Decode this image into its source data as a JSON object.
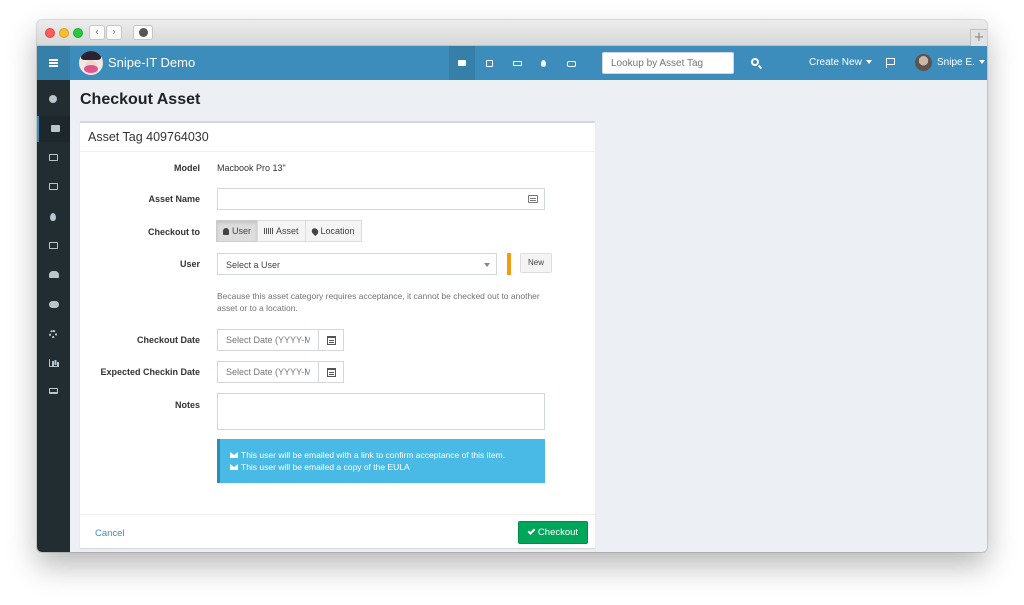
{
  "browser": {
    "back_glyph": "‹",
    "forward_glyph": "›",
    "newtab_glyph": "+"
  },
  "sidebar": {
    "items": [
      {
        "icon": "dashboard-icon"
      },
      {
        "icon": "barcode-icon",
        "active": true
      },
      {
        "icon": "save-icon"
      },
      {
        "icon": "keyboard-icon"
      },
      {
        "icon": "tint-icon"
      },
      {
        "icon": "hdd-icon"
      },
      {
        "icon": "users-icon"
      },
      {
        "icon": "cloud-download-icon"
      },
      {
        "icon": "cog-icon"
      },
      {
        "icon": "bar-chart-icon"
      },
      {
        "icon": "laptop-icon"
      }
    ]
  },
  "topbar": {
    "brand": "Snipe-IT Demo",
    "icons": [
      "barcode-icon",
      "save-icon",
      "keyboard-icon",
      "tint-icon",
      "hdd-icon"
    ],
    "search_placeholder": "Lookup by Asset Tag",
    "create_new": "Create New",
    "user_name": "Snipe E.",
    "accent_color": "#3c8dbc"
  },
  "page": {
    "title": "Checkout Asset"
  },
  "form": {
    "box_title": "Asset Tag 409764030",
    "model_label": "Model",
    "model_value": "Macbook Pro 13\"",
    "asset_name_label": "Asset Name",
    "asset_name_value": "",
    "checkout_to_label": "Checkout to",
    "checkout_options": [
      "User",
      "Asset",
      "Location"
    ],
    "checkout_selected": "User",
    "user_label": "User",
    "user_select_placeholder": "Select a User",
    "new_button": "New",
    "help_text": "Because this asset category requires acceptance, it cannot be checked out to another asset or to a location.",
    "checkout_date_label": "Checkout Date",
    "checkout_date_placeholder": "Select Date (YYYY-MM-DD)",
    "expected_checkin_label": "Expected Checkin Date",
    "expected_checkin_placeholder": "Select Date (YYYY-MM-DD)",
    "notes_label": "Notes",
    "notes_value": "",
    "alert_lines": [
      "This user will be emailed with a link to confirm acceptance of this item.",
      "This user will be emailed a copy of the EULA"
    ],
    "cancel": "Cancel",
    "submit": "Checkout"
  }
}
